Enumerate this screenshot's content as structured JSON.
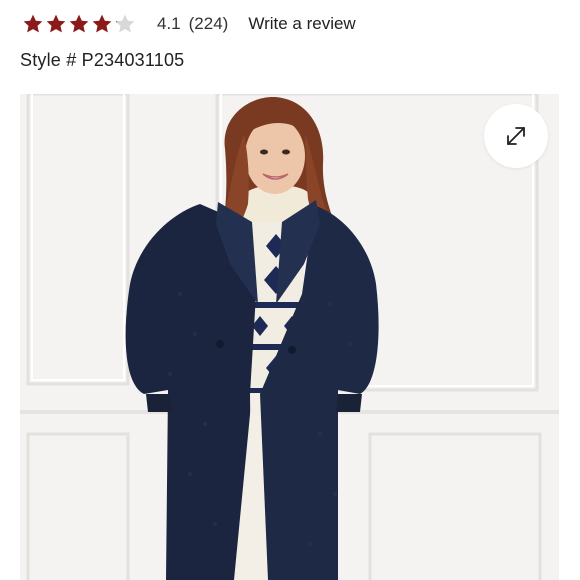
{
  "rating": {
    "value": "4.1",
    "count": "(224)",
    "stars_filled": 4,
    "stars_total": 5,
    "star_color": "#8b1a1a",
    "star_empty_color": "#d8d8d8",
    "write_review_label": "Write a review"
  },
  "product": {
    "style_label": "Style # P234031105",
    "image_icon": "expand-icon",
    "coat_color": "#1b2540"
  }
}
